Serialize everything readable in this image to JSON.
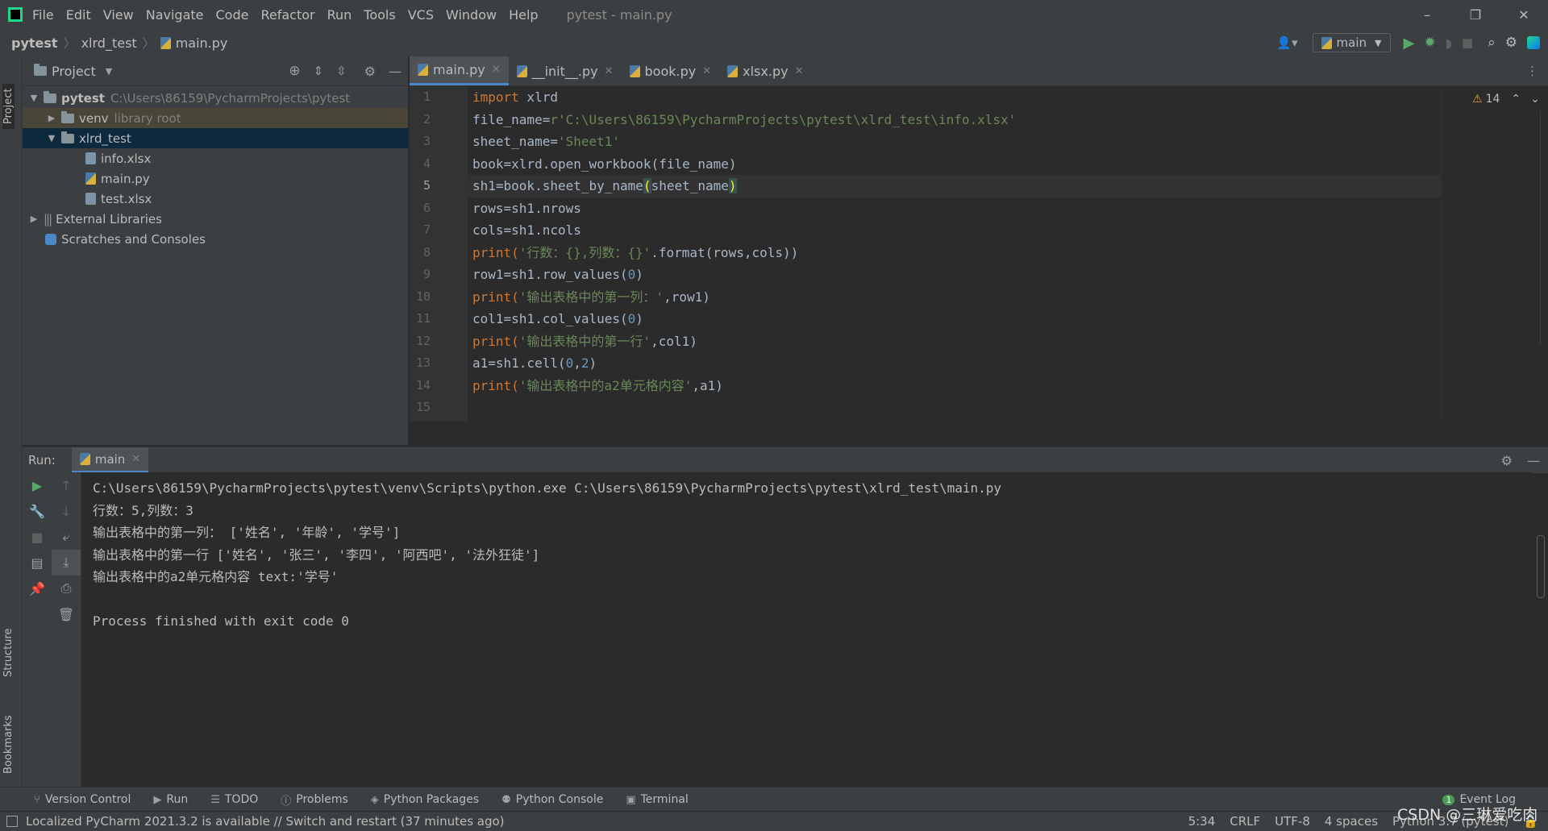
{
  "window": {
    "menu": [
      "File",
      "Edit",
      "View",
      "Navigate",
      "Code",
      "Refactor",
      "Run",
      "Tools",
      "VCS",
      "Window",
      "Help"
    ],
    "title": "pytest - main.py",
    "controls": [
      "–",
      "❐",
      "✕"
    ]
  },
  "navbar": {
    "crumbs": [
      "pytest",
      "xlrd_test",
      "main.py"
    ],
    "run_config": "main"
  },
  "left_stripe": {
    "project": "Project",
    "structure": "Structure",
    "bookmarks": "Bookmarks"
  },
  "project": {
    "title": "Project",
    "root": {
      "name": "pytest",
      "path": "C:\\Users\\86159\\PycharmProjects\\pytest"
    },
    "venv": {
      "name": "venv",
      "note": "library root"
    },
    "folder": "xlrd_test",
    "files": [
      "info.xlsx",
      "main.py",
      "test.xlsx"
    ],
    "external": "External Libraries",
    "scratches": "Scratches and Consoles"
  },
  "editor": {
    "tabs": [
      "main.py",
      "__init__.py",
      "book.py",
      "xlsx.py"
    ],
    "warnings": "14",
    "line_numbers": [
      "1",
      "2",
      "3",
      "4",
      "5",
      "6",
      "7",
      "8",
      "9",
      "10",
      "11",
      "12",
      "13",
      "14",
      "15"
    ],
    "lines": {
      "l1_kw": "import",
      "l1_rest": " xlrd",
      "l2_a": "file_name=",
      "l2_str": "r'C:\\Users\\86159\\PycharmProjects\\pytest\\xlrd_test\\info.xlsx'",
      "l3_a": "sheet_name=",
      "l3_str": "'Sheet1'",
      "l4": "book=xlrd.open_workbook(file_name)",
      "l5_a": "sh1=book.sheet_by_name",
      "l5_b": "(",
      "l5_c": "sheet_name",
      "l5_d": ")",
      "l6": "rows=sh1.nrows",
      "l7": "cols=sh1.ncols",
      "l8_a": "print(",
      "l8_str": "'行数：{},列数：{}'",
      "l8_b": ".format(rows,cols))",
      "l9_a": "row1=sh1.row_values(",
      "l9_num": "0",
      "l9_b": ")",
      "l10_a": "print(",
      "l10_str": "'输出表格中的第一列：'",
      "l10_b": ",row1)",
      "l11_a": "col1=sh1.col_values(",
      "l11_num": "0",
      "l11_b": ")",
      "l12_a": "print(",
      "l12_str": "'输出表格中的第一行'",
      "l12_b": ",col1)",
      "l13_a": "a1=sh1.cell(",
      "l13_n1": "0",
      "l13_c": ",",
      "l13_n2": "2",
      "l13_b": ")",
      "l14_a": "print(",
      "l14_str": "'输出表格中的a2单元格内容'",
      "l14_b": ",a1)"
    }
  },
  "run": {
    "label": "Run:",
    "tab": "main",
    "output": [
      "C:\\Users\\86159\\PycharmProjects\\pytest\\venv\\Scripts\\python.exe C:\\Users\\86159\\PycharmProjects\\pytest\\xlrd_test\\main.py",
      "行数：5,列数：3",
      "输出表格中的第一列： ['姓名', '年龄', '学号']",
      "输出表格中的第一行 ['姓名', '张三', '李四', '阿西吧', '法外狂徒']",
      "输出表格中的a2单元格内容 text:'学号'",
      "",
      "Process finished with exit code 0"
    ]
  },
  "bottom_tabs": [
    "Version Control",
    "Run",
    "TODO",
    "Problems",
    "Python Packages",
    "Python Console",
    "Terminal"
  ],
  "event_log": {
    "count": "1",
    "label": "Event Log"
  },
  "status": {
    "message": "Localized PyCharm 2021.3.2 is available // Switch and restart (37 minutes ago)",
    "position": "5:34",
    "line_sep": "CRLF",
    "encoding": "UTF-8",
    "indent": "4 spaces",
    "interpreter": "Python 3.7 (pytest)"
  },
  "watermark": "CSDN @三琳爱吃肉",
  "colors": {
    "keyword": "#cc7832",
    "string": "#6a8759",
    "number": "#6897bb",
    "accent": "#4a88c7"
  }
}
